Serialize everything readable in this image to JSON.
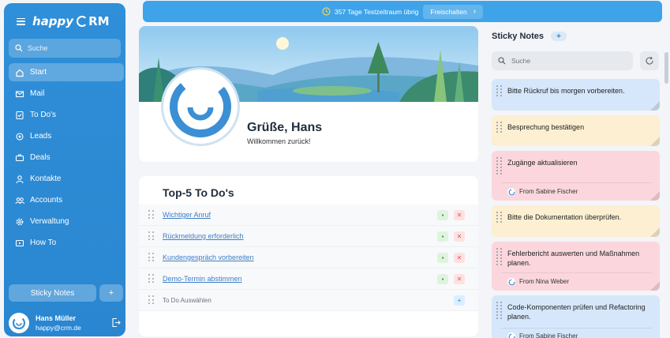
{
  "sidebar": {
    "logo_happy": "happy",
    "logo_crm": "RM",
    "search_placeholder": "Suche",
    "items": [
      {
        "label": "Start",
        "icon": "home-icon",
        "active": true
      },
      {
        "label": "Mail",
        "icon": "mail-icon"
      },
      {
        "label": "To Do's",
        "icon": "checklist-icon"
      },
      {
        "label": "Leads",
        "icon": "leads-icon"
      },
      {
        "label": "Deals",
        "icon": "deals-icon"
      },
      {
        "label": "Kontakte",
        "icon": "contacts-icon"
      },
      {
        "label": "Accounts",
        "icon": "accounts-icon"
      },
      {
        "label": "Verwaltung",
        "icon": "gear-icon"
      },
      {
        "label": "How To",
        "icon": "howto-icon"
      }
    ],
    "sticky_notes_label": "Sticky Notes",
    "plus_label": "+",
    "user": {
      "name": "Hans Müller",
      "email": "happy@crm.de"
    }
  },
  "trial_banner": {
    "text": "357 Tage Testzeitraum übrig",
    "button_label": "Freischalten"
  },
  "hero": {
    "greeting": "Grüße, Hans",
    "welcome": "Willkommen zurück!"
  },
  "todos": {
    "title": "Top-5 To Do's",
    "items": [
      {
        "label": "Wichtiger Anruf"
      },
      {
        "label": "Rückmeldung erforderlich"
      },
      {
        "label": "Kundengespräch vorbereiten"
      },
      {
        "label": "Demo-Termin abstimmen"
      }
    ],
    "select_placeholder": "To Do Auswählen"
  },
  "sticky_notes": {
    "title": "Sticky Notes",
    "add_label": "+",
    "search_placeholder": "Suche",
    "notes": [
      {
        "text": "Bitte Rückruf bis morgen vorbereiten.",
        "color": "#d6e7fb"
      },
      {
        "text": "Besprechung bestätigen",
        "color": "#fcefd2"
      },
      {
        "text": "Zugänge aktualisieren",
        "from": "From Sabine Fischer",
        "color": "#fbd7dd"
      },
      {
        "text": "Bitte die Dokumentation überprüfen.",
        "color": "#fcefd2"
      },
      {
        "text": "Fehlerbericht auswerten und Maßnahmen planen.",
        "from": "From Nina Weber",
        "color": "#fbd7dd"
      },
      {
        "text": "Code-Komponenten prüfen und Refactoring planen.",
        "from": "From Sabine Fischer",
        "color": "#d6e7fb"
      }
    ]
  },
  "colors": {
    "sidebar": "#2f8fd8",
    "banner": "#3fa3e9",
    "link": "#3d7fc6"
  }
}
